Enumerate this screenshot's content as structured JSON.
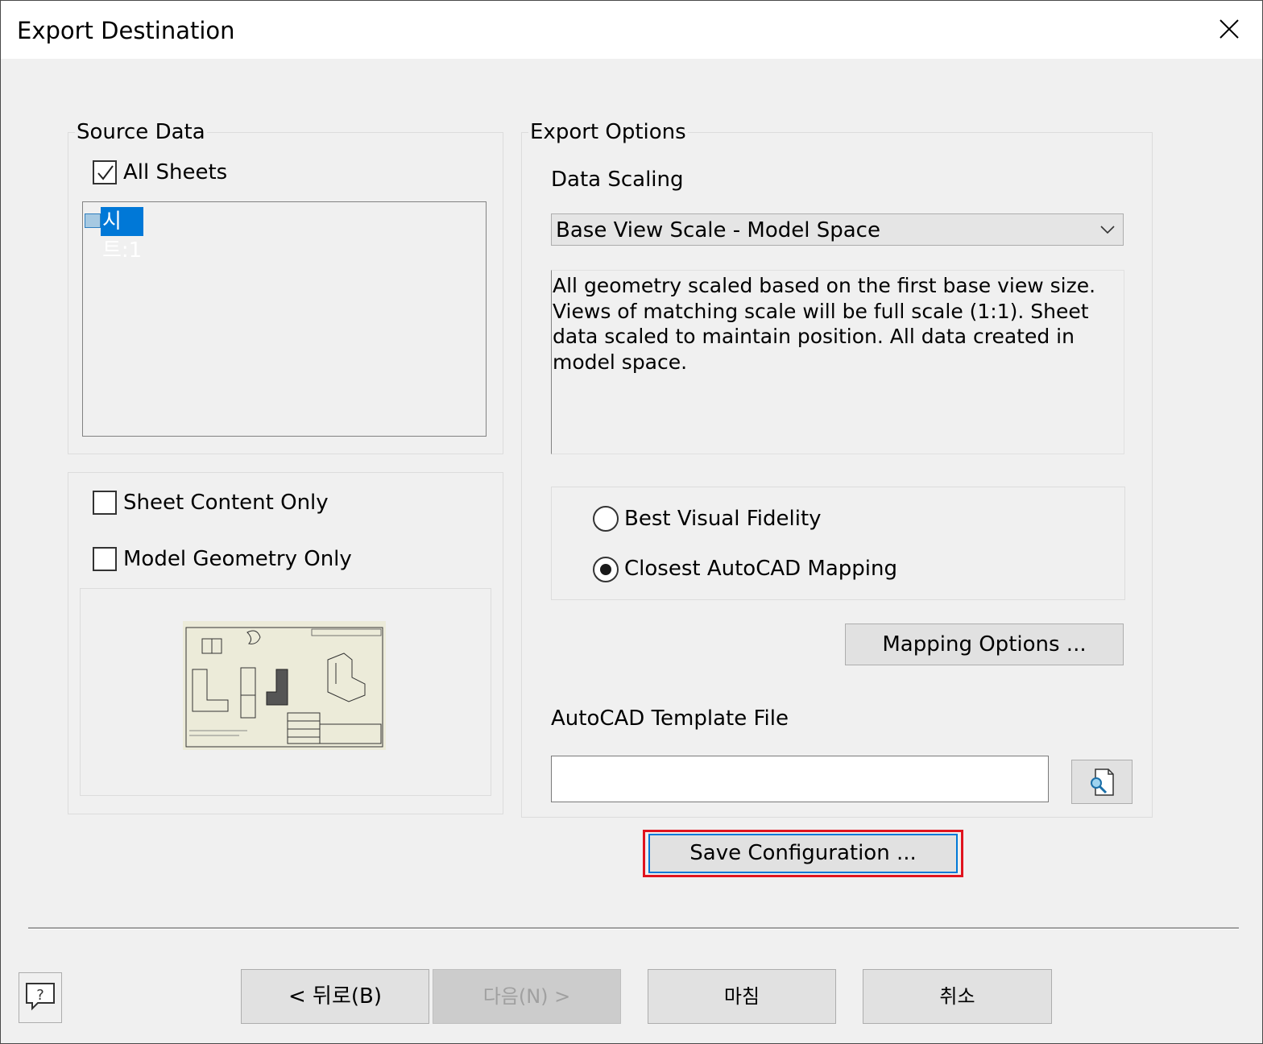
{
  "window": {
    "title": "Export Destination"
  },
  "source_data": {
    "legend": "Source Data",
    "all_sheets_label": "All Sheets",
    "all_sheets_checked": true,
    "sheets": [
      "시트:1"
    ]
  },
  "content_options": {
    "sheet_content_only": "Sheet Content Only",
    "model_geometry_only": "Model Geometry Only"
  },
  "export_options": {
    "legend": "Export Options",
    "data_scaling_label": "Data Scaling",
    "data_scaling_value": "Base View Scale - Model Space",
    "description": "All geometry scaled based on the first base view size. Views of matching scale will be full scale (1:1). Sheet data scaled to maintain position. All data created in model space.",
    "radio_best": "Best Visual Fidelity",
    "radio_closest": "Closest AutoCAD Mapping",
    "selected_mapping": "Closest AutoCAD Mapping",
    "mapping_button": "Mapping Options ...",
    "template_label": "AutoCAD Template File",
    "template_value": ""
  },
  "save_button": "Save Configuration ...",
  "footer": {
    "back": "< 뒤로(B)",
    "next": "다음(N) >",
    "finish": "마침",
    "cancel": "취소"
  },
  "colors": {
    "selection": "#0078d7",
    "highlight_border": "#e0141e"
  }
}
